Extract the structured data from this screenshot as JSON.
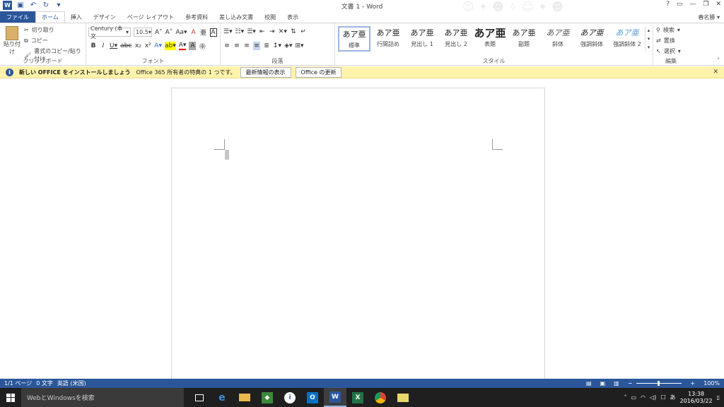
{
  "app": {
    "title": "文書 1 - Word",
    "user": "春名勝"
  },
  "tabs": [
    "ファイル",
    "ホーム",
    "挿入",
    "デザイン",
    "ページ レイアウト",
    "参考資料",
    "差し込み文書",
    "校閲",
    "表示"
  ],
  "clipboard": {
    "paste": "貼り付け",
    "cut": "切り取り",
    "copy": "コピー",
    "format_painter": "書式のコピー/貼り付け",
    "label": "クリップボード"
  },
  "font": {
    "name": "Century (本文",
    "size": "10.5",
    "label": "フォント"
  },
  "paragraph": {
    "label": "段落"
  },
  "styles": {
    "label": "スタイル",
    "items": [
      {
        "sample": "あア亜",
        "name": "標準"
      },
      {
        "sample": "あア亜",
        "name": "行間詰め"
      },
      {
        "sample": "あア亜",
        "name": "見出し 1"
      },
      {
        "sample": "あア亜",
        "name": "見出し 2"
      },
      {
        "sample": "あア亜",
        "name": "表題"
      },
      {
        "sample": "あア亜",
        "name": "副題"
      },
      {
        "sample": "あア亜",
        "name": "斜体"
      },
      {
        "sample": "あア亜",
        "name": "強調斜体"
      },
      {
        "sample": "あア亜",
        "name": "強調斜体 2"
      }
    ]
  },
  "editing": {
    "find": "検索",
    "replace": "置換",
    "select": "選択",
    "label": "編集"
  },
  "infobar": {
    "title": "新しい OFFICE をインストールしましょう",
    "message": "Office 365 所有者の特典の 1 つです。",
    "btn1": "最新情報の表示",
    "btn2": "Office の更新"
  },
  "status": {
    "page": "1/1 ページ",
    "words": "0 文字",
    "lang": "英語 (米国)",
    "zoom": "100%"
  },
  "taskbar": {
    "search": "WebとWindowsを検索",
    "time": "13:38",
    "date": "2016/03/22",
    "ime": "あ"
  },
  "colors": {
    "accent": "#2b579a",
    "infobar": "#fff3ab"
  }
}
